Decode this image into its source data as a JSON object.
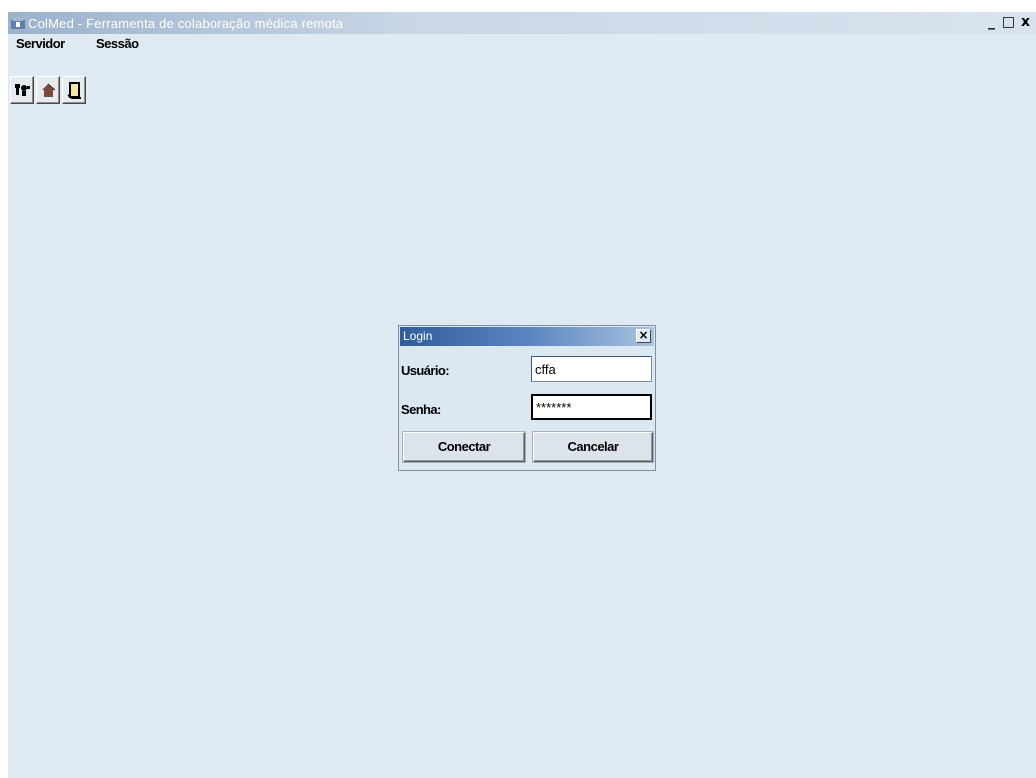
{
  "window": {
    "title": "ColMed - Ferramenta de colaboração médica remota",
    "controls": {
      "minimize": "_",
      "maximize": "□",
      "close": "x"
    }
  },
  "menubar": {
    "items": [
      {
        "label": "Servidor"
      },
      {
        "label": "Sessão"
      }
    ]
  },
  "toolbar": {
    "buttons": [
      {
        "icon": "connect-icon"
      },
      {
        "icon": "home-icon"
      },
      {
        "icon": "scroll-icon"
      }
    ]
  },
  "login_dialog": {
    "title": "Login",
    "close_symbol": "×",
    "username_label": "Usuário:",
    "username_value": "cffa",
    "password_label": "Senha:",
    "password_value": "*******",
    "connect_label": "Conectar",
    "cancel_label": "Cancelar"
  },
  "colors": {
    "desktop": "#dfe9f2",
    "dialog_title": "#2f5c9b",
    "window_title": "#9bb2cc"
  }
}
